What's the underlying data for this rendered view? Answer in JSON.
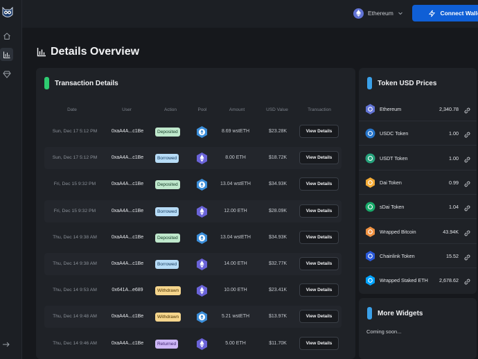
{
  "header": {
    "network_label": "Ethereum",
    "connect_label": "Connect Wallet"
  },
  "page": {
    "title": "Details Overview"
  },
  "transactions": {
    "title": "Transaction Details",
    "columns": [
      "Date",
      "User",
      "Action",
      "Pool",
      "Amount",
      "USD Value",
      "Transaction"
    ],
    "rows": [
      {
        "date": "Sun, Dec 17 5:12 PM",
        "user": "0xaA4A...c1Be",
        "action": "Deposited",
        "action_type": "deposited",
        "pool_icon": "wsteth-icon",
        "amount": "8.69  wstETH",
        "usd": "$23.28K",
        "button": "View Details"
      },
      {
        "date": "Sun, Dec 17 5:12 PM",
        "user": "0xaA4A...c1Be",
        "action": "Borrowed",
        "action_type": "borrowed",
        "pool_icon": "eth-icon",
        "amount": "8.00  ETH",
        "usd": "$18.72K",
        "button": "View Details"
      },
      {
        "date": "Fri, Dec 15 9:32 PM",
        "user": "0xaA4A...c1Be",
        "action": "Deposited",
        "action_type": "deposited",
        "pool_icon": "wsteth-icon",
        "amount": "13.04  wstETH",
        "usd": "$34.93K",
        "button": "View Details"
      },
      {
        "date": "Fri, Dec 15 9:32 PM",
        "user": "0xaA4A...c1Be",
        "action": "Borrowed",
        "action_type": "borrowed",
        "pool_icon": "eth-icon",
        "amount": "12.00  ETH",
        "usd": "$28.09K",
        "button": "View Details"
      },
      {
        "date": "Thu, Dec 14 9:38 AM",
        "user": "0xaA4A...c1Be",
        "action": "Deposited",
        "action_type": "deposited",
        "pool_icon": "wsteth-icon",
        "amount": "13.04  wstETH",
        "usd": "$34.93K",
        "button": "View Details"
      },
      {
        "date": "Thu, Dec 14 9:38 AM",
        "user": "0xaA4A...c1Be",
        "action": "Borrowed",
        "action_type": "borrowed",
        "pool_icon": "eth-icon",
        "amount": "14.00  ETH",
        "usd": "$32.77K",
        "button": "View Details"
      },
      {
        "date": "Thu, Dec 14 9:53 AM",
        "user": "0x641A...e689",
        "action": "Withdrawn",
        "action_type": "withdrawn",
        "pool_icon": "eth-icon",
        "amount": "10.00  ETH",
        "usd": "$23.41K",
        "button": "View Details"
      },
      {
        "date": "Thu, Dec 14 9:48 AM",
        "user": "0xaA4A...c1Be",
        "action": "Withdrawn",
        "action_type": "withdrawn",
        "pool_icon": "wsteth-icon",
        "amount": "5.21  wstETH",
        "usd": "$13.97K",
        "button": "View Details"
      },
      {
        "date": "Thu, Dec 14 9:46 AM",
        "user": "0xaA4A...c1Be",
        "action": "Returned",
        "action_type": "returned",
        "pool_icon": "eth-icon",
        "amount": "5.00  ETH",
        "usd": "$11.70K",
        "button": "View Details"
      }
    ]
  },
  "prices": {
    "title": "Token USD Prices",
    "tokens": [
      {
        "name": "Ethereum",
        "price": "2,340.78",
        "icon": "eth-icon",
        "color": "#6173d4"
      },
      {
        "name": "USDC Token",
        "price": "1.00",
        "icon": "usdc-icon",
        "color": "#2775ca"
      },
      {
        "name": "USDT Token",
        "price": "1.00",
        "icon": "usdt-icon",
        "color": "#26a17b"
      },
      {
        "name": "Dai Token",
        "price": "0.99",
        "icon": "dai-icon",
        "color": "#f5ac37"
      },
      {
        "name": "sDai Token",
        "price": "1.04",
        "icon": "sdai-icon",
        "color": "#1aab6b"
      },
      {
        "name": "Wrapped Bitcoin",
        "price": "43.94K",
        "icon": "wbtc-icon",
        "color": "#f09242"
      },
      {
        "name": "Chainlink Token",
        "price": "15.52",
        "icon": "link-token-icon",
        "color": "#2a5ada"
      },
      {
        "name": "Wrapped Staked ETH",
        "price": "2,678.62",
        "icon": "wsteth-icon",
        "color": "#00a3ff"
      }
    ]
  },
  "widgets": {
    "title": "More Widgets",
    "text": "Coming soon..."
  },
  "colors": {
    "accent_green": "#2ecc71",
    "accent_blue": "#3aa0e8",
    "primary_button": "#0f5fd6"
  }
}
